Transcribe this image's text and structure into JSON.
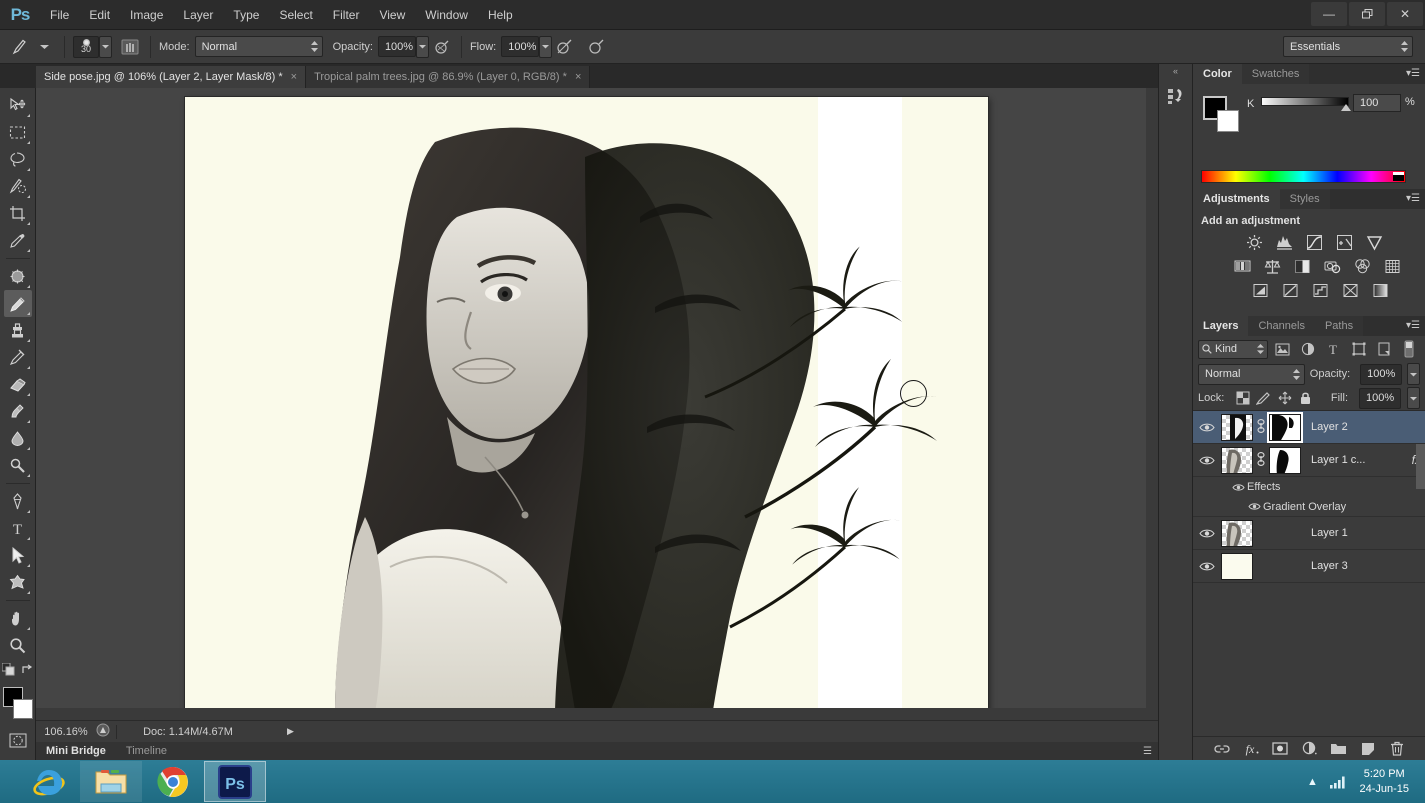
{
  "app": {
    "logo": "Ps",
    "menus": [
      "File",
      "Edit",
      "Image",
      "Layer",
      "Type",
      "Select",
      "Filter",
      "View",
      "Window",
      "Help"
    ],
    "window_buttons": {
      "minimize": "—",
      "restore": "❐",
      "close": "✕"
    }
  },
  "options_bar": {
    "brush_size": "30",
    "mode_label": "Mode:",
    "mode_value": "Normal",
    "opacity_label": "Opacity:",
    "opacity_value": "100%",
    "flow_label": "Flow:",
    "flow_value": "100%",
    "airbrush_icon": "airbrush-icon",
    "tablet_pressure_opacity_icon": "pressure-opacity-icon",
    "tablet_pressure_size_icon": "pressure-size-icon",
    "workspace_value": "Essentials"
  },
  "tabs": [
    {
      "label": "Side pose.jpg @ 106% (Layer 2, Layer Mask/8) *",
      "close": "×",
      "active": true
    },
    {
      "label": "Tropical palm trees.jpg @ 86.9% (Layer 0, RGB/8) *",
      "close": "×",
      "active": false
    }
  ],
  "tools": [
    {
      "name": "move-tool",
      "glyph": "move"
    },
    {
      "name": "marquee-tool",
      "glyph": "marquee"
    },
    {
      "name": "lasso-tool",
      "glyph": "lasso"
    },
    {
      "name": "quick-selection-tool",
      "glyph": "quickselect"
    },
    {
      "name": "crop-tool",
      "glyph": "crop"
    },
    {
      "name": "eyedropper-tool",
      "glyph": "eyedropper"
    },
    {
      "name": "spot-healing-brush-tool",
      "glyph": "heal"
    },
    {
      "name": "brush-tool",
      "glyph": "brush",
      "active": true
    },
    {
      "name": "clone-stamp-tool",
      "glyph": "stamp"
    },
    {
      "name": "history-brush-tool",
      "glyph": "historybrush"
    },
    {
      "name": "eraser-tool",
      "glyph": "eraser"
    },
    {
      "name": "gradient-tool",
      "glyph": "gradient"
    },
    {
      "name": "blur-tool",
      "glyph": "blur"
    },
    {
      "name": "dodge-tool",
      "glyph": "dodge"
    },
    {
      "name": "pen-tool",
      "glyph": "pen"
    },
    {
      "name": "type-tool",
      "glyph": "type"
    },
    {
      "name": "path-selection-tool",
      "glyph": "pathselect"
    },
    {
      "name": "shape-tool",
      "glyph": "shape"
    },
    {
      "name": "hand-tool",
      "glyph": "hand"
    },
    {
      "name": "zoom-tool",
      "glyph": "zoom"
    }
  ],
  "tool_colors": {
    "foreground": "#000000",
    "background": "#ffffff"
  },
  "canvas": {
    "background_color": "#fafaea",
    "strip_color": "#ffffff",
    "brush_cursor_diameter": "30"
  },
  "status_bar": {
    "zoom": "106.16%",
    "doc_label": "Doc: 1.14M/4.67M",
    "arrow": "▶"
  },
  "bottom_tabs": [
    {
      "label": "Mini Bridge",
      "active": true
    },
    {
      "label": "Timeline",
      "active": false
    }
  ],
  "color_panel": {
    "tabs": [
      {
        "label": "Color",
        "active": true
      },
      {
        "label": "Swatches",
        "active": false
      }
    ],
    "channel_label": "K",
    "value": "100",
    "unit": "%",
    "foreground": "#000000",
    "background": "#ffffff"
  },
  "adjustments_panel": {
    "tabs": [
      {
        "label": "Adjustments",
        "active": true
      },
      {
        "label": "Styles",
        "active": false
      }
    ],
    "title": "Add an adjustment",
    "row1": [
      "brightness-contrast-icon",
      "levels-icon",
      "curves-icon",
      "exposure-icon",
      "vibrance-icon"
    ],
    "row2": [
      "hue-saturation-icon",
      "color-balance-icon",
      "black-white-icon",
      "photo-filter-icon",
      "channel-mixer-icon",
      "color-lookup-icon"
    ],
    "row3": [
      "invert-icon",
      "posterize-icon",
      "threshold-icon",
      "selective-color-icon",
      "gradient-map-icon"
    ]
  },
  "layers_panel": {
    "tabs": [
      {
        "label": "Layers",
        "active": true
      },
      {
        "label": "Channels",
        "active": false
      },
      {
        "label": "Paths",
        "active": false
      }
    ],
    "filter_kind": "Kind",
    "filter_icons": [
      "filter-pixel-icon",
      "filter-adjustment-icon",
      "filter-type-icon",
      "filter-shape-icon",
      "filter-smart-icon"
    ],
    "blend_mode": "Normal",
    "opacity_label": "Opacity:",
    "opacity_value": "100%",
    "lock_label": "Lock:",
    "lock_icons": [
      "lock-transparent-icon",
      "lock-image-icon",
      "lock-position-icon",
      "lock-all-icon"
    ],
    "fill_label": "Fill:",
    "fill_value": "100%",
    "layers": [
      {
        "name": "Layer 2",
        "selected": true,
        "has_mask": true,
        "mask_selected": true,
        "linked": true,
        "fx": false,
        "thumb": "portrait-mask"
      },
      {
        "name": "Layer 1 c...",
        "selected": false,
        "has_mask": true,
        "mask_selected": false,
        "linked": true,
        "fx": true,
        "fx_label": "fx",
        "thumb": "portrait-soft"
      },
      {
        "name": "Layer 1",
        "selected": false,
        "has_mask": false,
        "linked": false,
        "fx": false,
        "thumb": "portrait-plain"
      },
      {
        "name": "Layer 3",
        "selected": false,
        "has_mask": false,
        "linked": false,
        "fx": false,
        "thumb": "cream-fill"
      }
    ],
    "effects": [
      {
        "label": "Effects",
        "indent": 1
      },
      {
        "label": "Gradient Overlay",
        "indent": 2
      }
    ],
    "footer_icons": [
      "link-layers-icon",
      "add-style-icon",
      "add-mask-icon",
      "new-adjustment-icon",
      "new-group-icon",
      "new-layer-icon",
      "delete-layer-icon"
    ],
    "selected_color": "#4a5d75"
  },
  "mini_dock": {
    "collapse": "«",
    "icons": [
      "history-icon"
    ]
  },
  "taskbar": {
    "items": [
      {
        "name": "internet-explorer",
        "active": false
      },
      {
        "name": "file-explorer",
        "active": false
      },
      {
        "name": "google-chrome",
        "active": false
      },
      {
        "name": "photoshop",
        "active": true,
        "label": "Ps"
      }
    ],
    "tray": {
      "show_hidden": "▲",
      "network": "network-icon"
    },
    "time": "5:20 PM",
    "date": "24-Jun-15"
  }
}
